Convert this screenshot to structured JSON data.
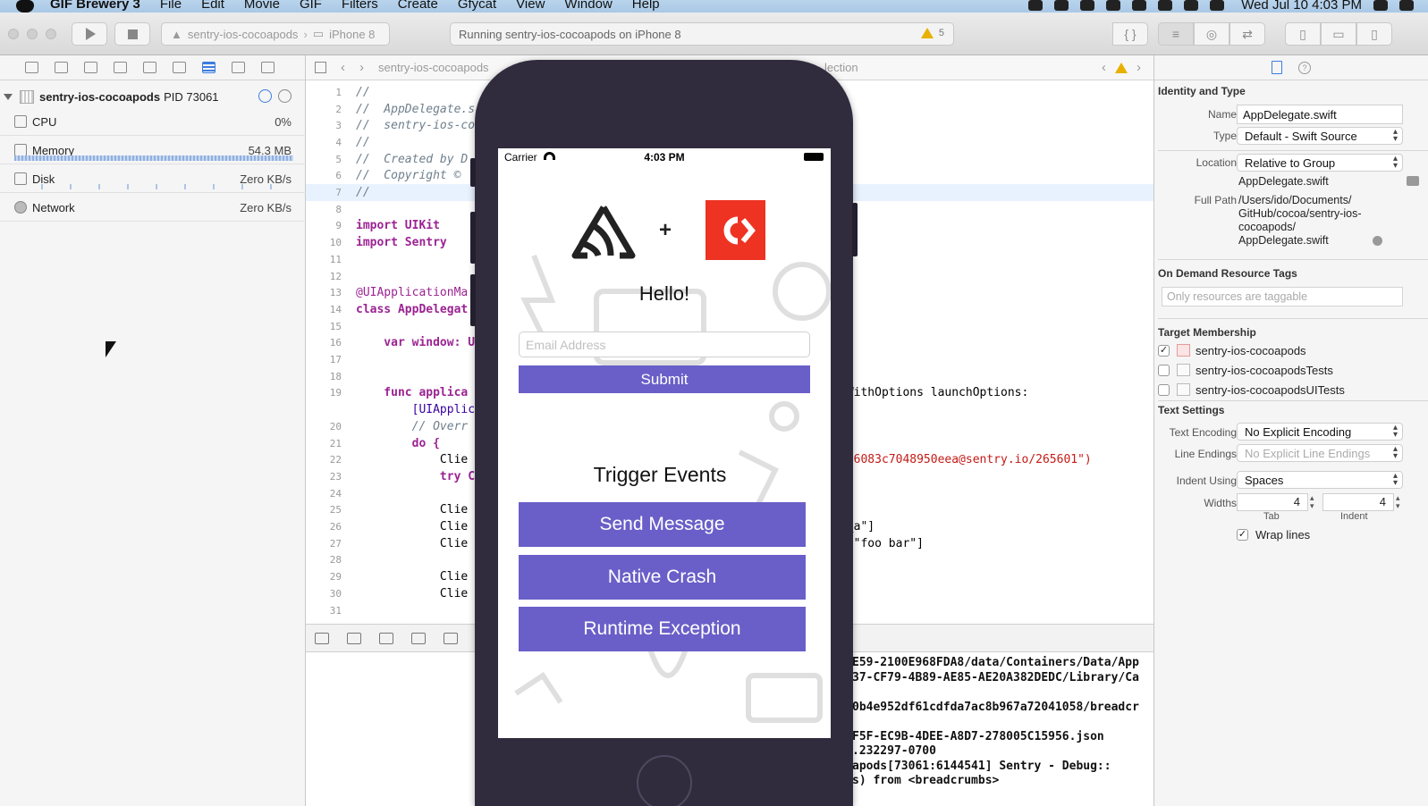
{
  "menubar": {
    "app_name": "GIF Brewery 3",
    "menus": [
      "File",
      "Edit",
      "Movie",
      "GIF",
      "Filters",
      "Create",
      "Gfycat",
      "View",
      "Window",
      "Help"
    ],
    "clock": "Wed Jul 10  4:03 PM"
  },
  "toolbar": {
    "scheme": "sentry-ios-cocoapods",
    "device": "iPhone 8",
    "activity": "Running sentry-ios-cocoapods on iPhone 8",
    "warning_count": "5"
  },
  "navigator": {
    "process_name": "sentry-ios-cocoapods",
    "pid": "PID 73061",
    "gauges": [
      {
        "label": "CPU",
        "value": "0%"
      },
      {
        "label": "Memory",
        "value": "54.3 MB"
      },
      {
        "label": "Disk",
        "value": "Zero KB/s"
      },
      {
        "label": "Network",
        "value": "Zero KB/s"
      }
    ]
  },
  "editor": {
    "jump_file": "sentry-ios-cocoapods",
    "jump_right": "lection",
    "lines": [
      {
        "n": "1",
        "t": "//"
      },
      {
        "n": "2",
        "t": "//  AppDelegate.s"
      },
      {
        "n": "3",
        "t": "//  sentry-ios-co"
      },
      {
        "n": "4",
        "t": "//"
      },
      {
        "n": "5",
        "t": "//  Created by D"
      },
      {
        "n": "6",
        "t": "//  Copyright ©"
      },
      {
        "n": "7",
        "t": "//"
      },
      {
        "n": "8",
        "t": ""
      },
      {
        "n": "9",
        "t": "import UIKit"
      },
      {
        "n": "10",
        "t": "import Sentry"
      },
      {
        "n": "11",
        "t": ""
      },
      {
        "n": "12",
        "t": ""
      },
      {
        "n": "13",
        "t": "@UIApplicationMa"
      },
      {
        "n": "14",
        "t": "class AppDelegat"
      },
      {
        "n": "15",
        "t": ""
      },
      {
        "n": "16",
        "t": "    var window: U"
      },
      {
        "n": "17",
        "t": ""
      },
      {
        "n": "18",
        "t": ""
      },
      {
        "n": "19",
        "t": "    func applica",
        "right": "gWithOptions launchOptions:"
      },
      {
        "n": "",
        "t": "        [UIApplic"
      },
      {
        "n": "20",
        "t": "        // Overr"
      },
      {
        "n": "21",
        "t": "        do {"
      },
      {
        "n": "22",
        "t": "            Clie",
        "right": "0a6083c7048950eea@sentry.io/265601\")"
      },
      {
        "n": "23",
        "t": "            try C"
      },
      {
        "n": "24",
        "t": ""
      },
      {
        "n": "25",
        "t": "            Clie"
      },
      {
        "n": "26",
        "t": "            Clie",
        "right": "e_a\"]"
      },
      {
        "n": "27",
        "t": "            Clie",
        "right": ": \"foo bar\"]"
      },
      {
        "n": "28",
        "t": ""
      },
      {
        "n": "29",
        "t": "            Clie"
      },
      {
        "n": "30",
        "t": "            Clie"
      },
      {
        "n": "31",
        "t": ""
      }
    ],
    "console": [
      "E59-2100E968FDA8/data/Containers/Data/App",
      "37-CF79-4B89-AE85-AE20A382DEDC/Library/Ca",
      "",
      "0b4e952df61cdfda7ac8b967a72041058/breadcr",
      "",
      "F5F-EC9B-4DEE-A8D7-278005C15956.json",
      ".232297-0700",
      "apods[73061:6144541] Sentry - Debug::",
      "s) from <breadcrumbs>"
    ]
  },
  "inspector": {
    "identity_title": "Identity and Type",
    "name_label": "Name",
    "name_value": "AppDelegate.swift",
    "type_label": "Type",
    "type_value": "Default - Swift Source",
    "location_label": "Location",
    "location_value": "Relative to Group",
    "location_file": "AppDelegate.swift",
    "fullpath_label": "Full Path",
    "fullpath_lines": [
      "/Users/ido/Documents/",
      "GitHub/cocoa/sentry-ios-",
      "cocoapods/",
      "AppDelegate.swift"
    ],
    "odr_title": "On Demand Resource Tags",
    "odr_placeholder": "Only resources are taggable",
    "target_title": "Target Membership",
    "targets": [
      {
        "name": "sentry-ios-cocoapods",
        "checked": "✓"
      },
      {
        "name": "sentry-ios-cocoapodsTests",
        "checked": ""
      },
      {
        "name": "sentry-ios-cocoapodsUITests",
        "checked": ""
      }
    ],
    "text_title": "Text Settings",
    "encoding_label": "Text Encoding",
    "encoding_value": "No Explicit Encoding",
    "endings_label": "Line Endings",
    "endings_value": "No Explicit Line Endings",
    "indent_label": "Indent Using",
    "indent_value": "Spaces",
    "widths_label": "Widths",
    "tab_value": "4",
    "indent_width_value": "4",
    "tab_label": "Tab",
    "indent_label_small": "Indent",
    "wrap_label": "Wrap lines",
    "wrap_checked": "✓"
  },
  "phone": {
    "carrier": "Carrier",
    "time": "4:03 PM",
    "plus": "+",
    "hello": "Hello!",
    "email_placeholder": "Email Address",
    "submit": "Submit",
    "trigger_title": "Trigger Events",
    "buttons": [
      "Send Message",
      "Native Crash",
      "Runtime Exception"
    ],
    "accent": "#6a5fc8",
    "cocoapods_red": "#ee3322"
  }
}
